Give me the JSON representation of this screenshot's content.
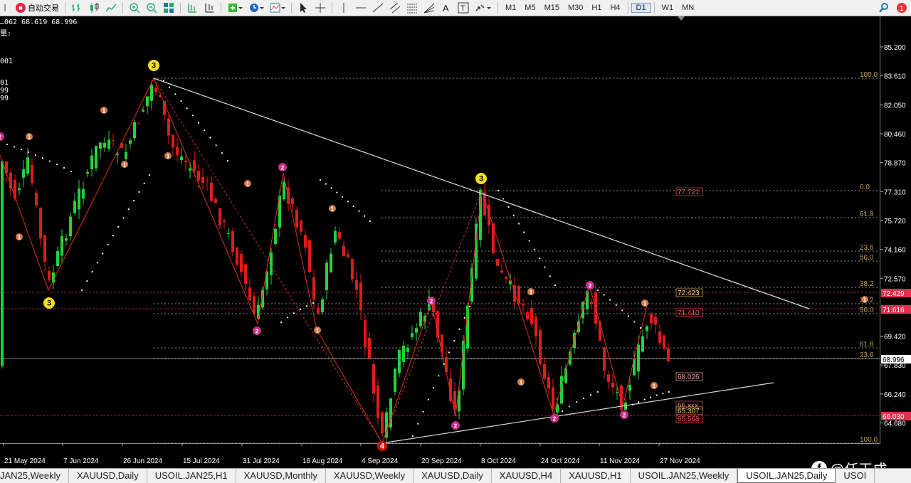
{
  "toolbar": {
    "auto_trade_label": "自动交易",
    "timeframes": [
      "M1",
      "M5",
      "M15",
      "M30",
      "H1",
      "H4",
      "D1",
      "W1",
      "MN"
    ],
    "active_timeframe": "D1",
    "tools": [
      "bar-chart-icon",
      "candles-icon",
      "line-chart-icon",
      "zoom-in-icon",
      "zoom-out-icon",
      "tile-icon",
      "period-separators-icon",
      "autoscroll-icon",
      "indicators-icon",
      "clock-icon",
      "templates-icon",
      "cursor-icon",
      "crosshair-icon",
      "vertical-line-icon",
      "horizontal-line-icon",
      "trendline-icon",
      "channel-icon",
      "fibonacci-icon",
      "fibonacci-fan-icon",
      "text-icon",
      "text-label-icon",
      "arrows-icon"
    ]
  },
  "info": {
    "ohlc": "…062 68.619 68.996",
    "line2": "量:",
    "side_values": [
      "001",
      "01",
      "99",
      "99"
    ]
  },
  "price_axis": {
    "labels": [
      "85.200",
      "83.610",
      "82.050",
      "80.460",
      "78.870",
      "77.310",
      "75.720",
      "74.160",
      "72.570",
      "70.980",
      "69.420",
      "67.830",
      "66.240",
      "64.680"
    ],
    "current_price": "68.996",
    "tag_72429": "72.429",
    "tag_71616": "71.616",
    "tag_66030": "66.030"
  },
  "date_axis": [
    "21 May 2024",
    "7 Jun 2024",
    "26 Jun 2024",
    "15 Jul 2024",
    "31 Jul 2024",
    "16 Aug 2024",
    "4 Sep 2024",
    "20 Sep 2024",
    "8 Oct 2024",
    "24 Oct 2024",
    "11 Nov 2024",
    "27 Nov 2024"
  ],
  "fib_levels": [
    "100.0",
    "0.0",
    "61.8",
    "23.6",
    "50.0",
    "38.2",
    "38.2",
    "50.0",
    "61.8",
    "23.6",
    "100.0"
  ],
  "price_boxes": [
    "77.721",
    "72.423",
    "71.410",
    "68.026",
    "66.xxx",
    "65.307",
    "65.568"
  ],
  "wave_labels": [
    "3",
    "3",
    "3",
    "2",
    "2",
    "2",
    "2",
    "2",
    "2",
    "2",
    "2",
    "1",
    "1",
    "1",
    "1",
    "1",
    "1",
    "1",
    "1",
    "1",
    "1",
    "1",
    "1",
    "1",
    "4"
  ],
  "tabs": [
    "JAN25,Weekly",
    "XAUUSD,Daily",
    "USOIL.JAN25,H1",
    "XAUUSD,Monthly",
    "XAUUSD,Weekly",
    "XAUUSD,Daily",
    "XAUUSD,H4",
    "XAUUSD,H1",
    "USOIL.JAN25,Weekly",
    "USOIL.JAN25,Daily",
    "USOI"
  ],
  "active_tab": "USOIL.JAN25,Daily",
  "watermark": "@任天成",
  "colors": {
    "bull": "#22d33a",
    "bear": "#e01b1b",
    "fib": "#c8a050",
    "zigzag": "#d83020",
    "grid_dash": "#bbbbbb"
  }
}
